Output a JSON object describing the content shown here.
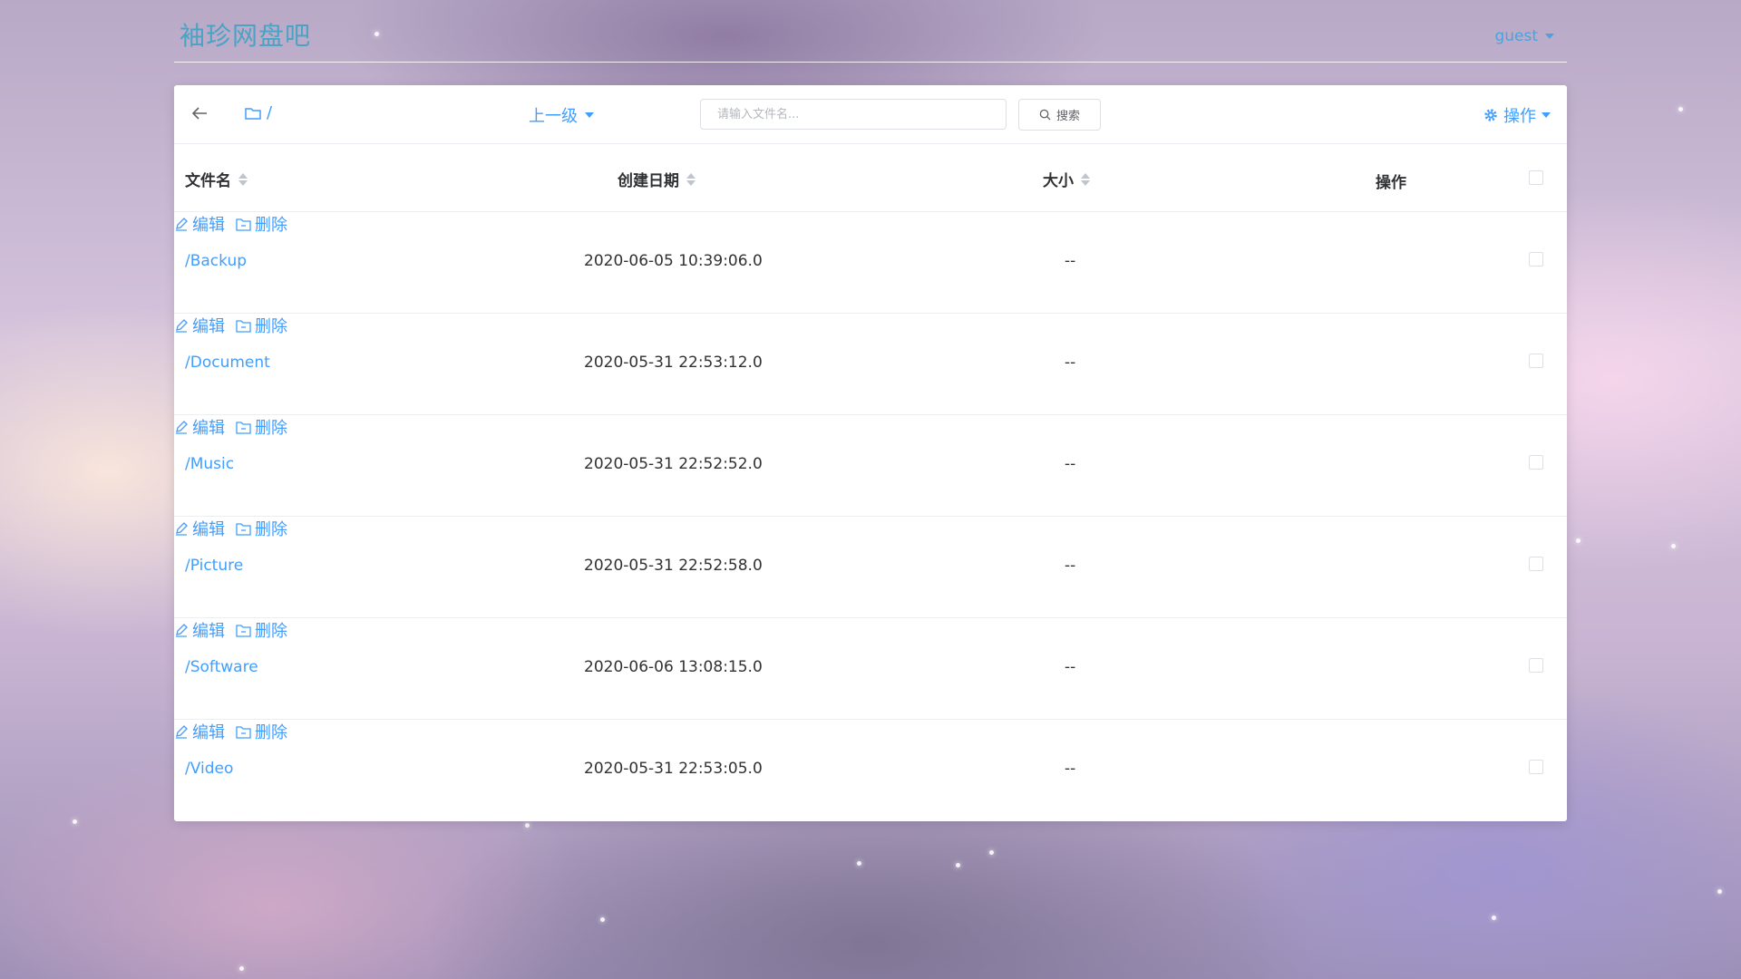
{
  "header": {
    "site_title": "袖珍网盘吧",
    "user": "guest"
  },
  "toolbar": {
    "path": "/",
    "parent_label": "上一级",
    "search_placeholder": "请输入文件名...",
    "search_button": "搜索",
    "ops_label": "操作"
  },
  "table": {
    "headers": {
      "name": "文件名",
      "created": "创建日期",
      "size": "大小",
      "actions": "操作"
    },
    "rows": [
      {
        "name": "/Backup",
        "created": "2020-06-05 10:39:06.0",
        "size": "--",
        "edit": "编辑",
        "delete": "删除"
      },
      {
        "name": "/Document",
        "created": "2020-05-31 22:53:12.0",
        "size": "--",
        "edit": "编辑",
        "delete": "删除"
      },
      {
        "name": "/Music",
        "created": "2020-05-31 22:52:52.0",
        "size": "--",
        "edit": "编辑",
        "delete": "删除"
      },
      {
        "name": "/Picture",
        "created": "2020-05-31 22:52:58.0",
        "size": "--",
        "edit": "编辑",
        "delete": "删除"
      },
      {
        "name": "/Software",
        "created": "2020-06-06 13:08:15.0",
        "size": "--",
        "edit": "编辑",
        "delete": "删除"
      },
      {
        "name": "/Video",
        "created": "2020-05-31 22:53:05.0",
        "size": "--",
        "edit": "编辑",
        "delete": "删除"
      }
    ]
  },
  "icons": {
    "back": "arrow-left-icon",
    "folder": "folder-icon",
    "search": "search-icon",
    "gear": "gear-icon",
    "edit": "edit-icon",
    "delete": "folder-delete-icon"
  },
  "colors": {
    "accent": "#409eff",
    "title": "#4aa3c4"
  }
}
